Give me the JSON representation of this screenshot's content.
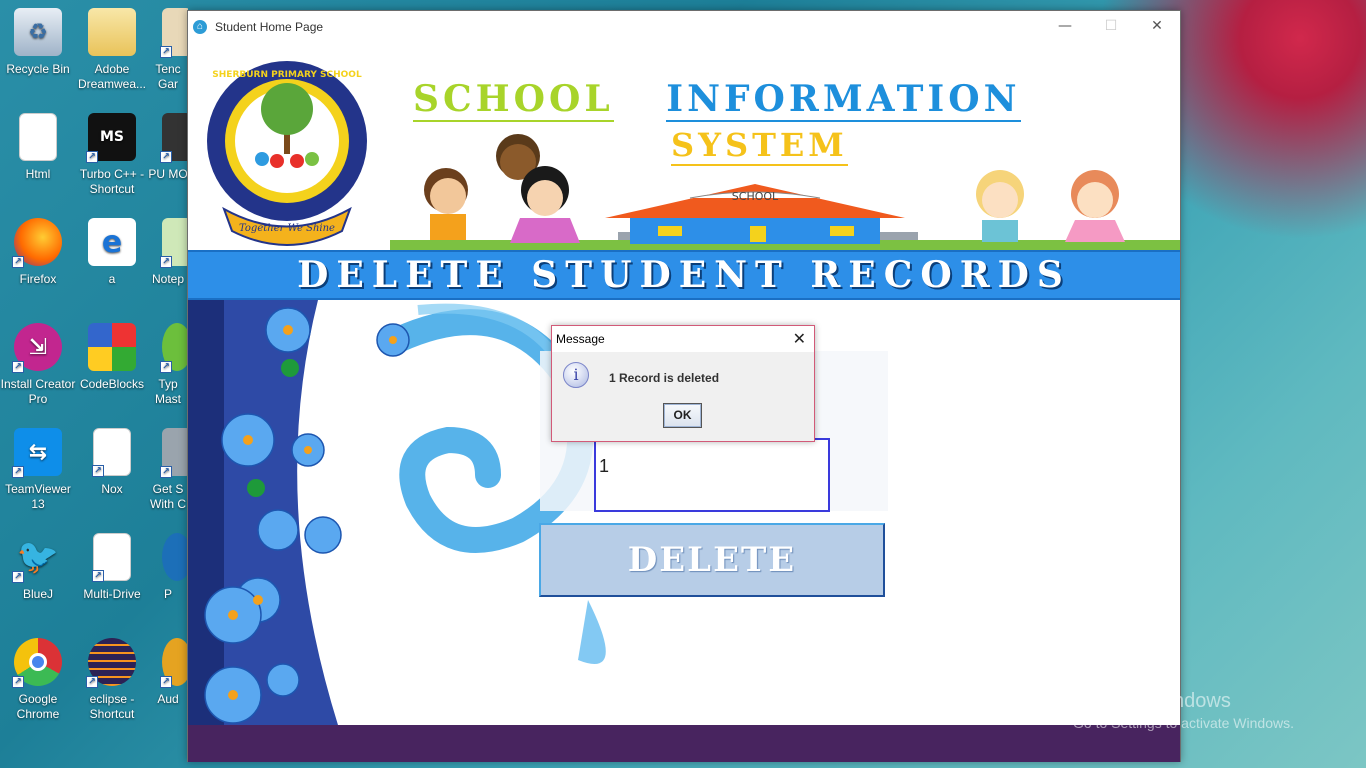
{
  "desktop": {
    "icons": [
      {
        "label": "Recycle Bin",
        "icon": "recycle-bin-icon"
      },
      {
        "label": "Adobe Dreamwea...",
        "icon": "folder-icon"
      },
      {
        "label": "Tenc Gar",
        "icon": "game-icon"
      },
      {
        "label": "Html",
        "icon": "document-icon"
      },
      {
        "label": "Turbo C++ - Shortcut",
        "icon": "turbo-cpp-icon"
      },
      {
        "label": "PU MO",
        "icon": "media-icon"
      },
      {
        "label": "Firefox",
        "icon": "firefox-icon"
      },
      {
        "label": "a",
        "icon": "edge-icon"
      },
      {
        "label": "Notep",
        "icon": "notepad-icon"
      },
      {
        "label": "Install Creator Pro",
        "icon": "install-creator-icon"
      },
      {
        "label": "CodeBlocks",
        "icon": "codeblocks-icon"
      },
      {
        "label": "Typ Mast",
        "icon": "typing-master-icon"
      },
      {
        "label": "TeamViewer 13",
        "icon": "teamviewer-icon"
      },
      {
        "label": "Nox",
        "icon": "document-icon"
      },
      {
        "label": "Get S With C",
        "icon": "database-icon"
      },
      {
        "label": "BlueJ",
        "icon": "bluej-icon"
      },
      {
        "label": "Multi-Drive",
        "icon": "document-icon"
      },
      {
        "label": "P",
        "icon": "app-icon"
      },
      {
        "label": "Google Chrome",
        "icon": "chrome-icon"
      },
      {
        "label": "eclipse - Shortcut",
        "icon": "eclipse-icon"
      },
      {
        "label": "Aud",
        "icon": "audio-icon"
      }
    ]
  },
  "window": {
    "title": "Student Home Page",
    "controls": {
      "minimize": "—",
      "maximize": "☐",
      "close": "✕"
    }
  },
  "banner": {
    "school_word": "SCHOOL",
    "information_word": "INFORMATION",
    "system_word": "SYSTEM",
    "logo_top_text": "SHERBURN PRIMARY SCHOOL",
    "logo_motto": "Together We Shine",
    "school_sign": "SCHOOL"
  },
  "heading": "DELETE STUDENT RECORDS",
  "form": {
    "id_value": "1",
    "delete_label": "DELETE"
  },
  "dialog": {
    "title": "Message",
    "message": "1 Record is deleted",
    "ok_label": "OK",
    "icon": "info-icon"
  },
  "watermark": {
    "line1": "Activate Windows",
    "line2": "Go to Settings to activate Windows."
  },
  "colors": {
    "heading_bar": "#2d8fe8",
    "footer_bar": "#48245f",
    "school_green": "#a8d42a",
    "info_blue": "#1d8fdc",
    "system_yellow": "#f5c21a",
    "delete_button": "#b7cde7"
  }
}
